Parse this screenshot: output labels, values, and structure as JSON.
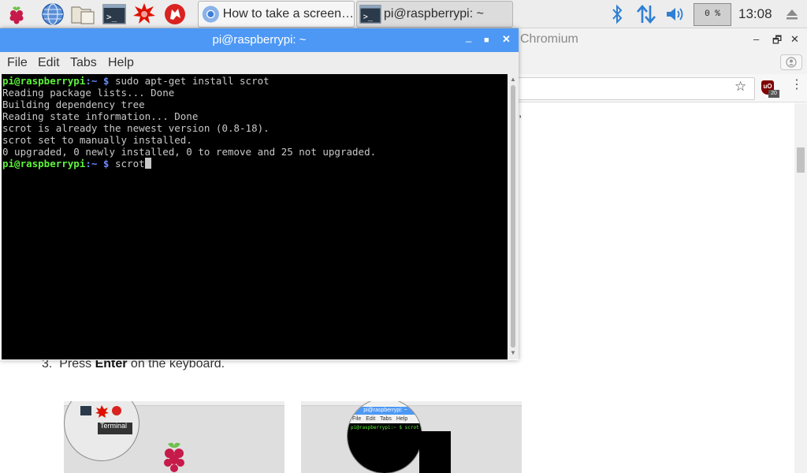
{
  "panel": {
    "launchers": [
      {
        "name": "raspberry-menu",
        "icon": "raspberry-icon"
      },
      {
        "name": "web-browser",
        "icon": "globe-icon"
      },
      {
        "name": "file-manager",
        "icon": "folder-icon"
      },
      {
        "name": "terminal",
        "icon": "terminal-icon"
      },
      {
        "name": "mathematica",
        "icon": "mathematica-icon"
      },
      {
        "name": "wolfram",
        "icon": "wolfram-icon"
      }
    ],
    "tasks": [
      {
        "label": "How to take a screen…",
        "icon": "chromium-icon",
        "active": true
      },
      {
        "label": "pi@raspberrypi: ~",
        "icon": "terminal-icon",
        "active": false
      }
    ],
    "cpu": "0 %",
    "clock": "13:08",
    "colors": {
      "bluetooth": "#2f7fd5",
      "network": "#2f7fd5",
      "volume": "#2f7fd5"
    }
  },
  "chromium": {
    "title_fragment": "Chromium",
    "minimize": "–",
    "maximize": "🗗",
    "close": "✕",
    "ublock_label": "uO",
    "ublock_count": "20",
    "content_fragment": "’,",
    "step_number": "3.",
    "step_pre": "Press ",
    "step_bold": "Enter",
    "step_post": " on the keyboard.",
    "thumb1_tooltip": "Terminal",
    "thumb2_title": "pi@raspberrypi: ~",
    "thumb2_menu": [
      "File",
      "Edit",
      "Tabs",
      "Help"
    ],
    "thumb2_prompt": "pi@raspberrypi:~ $ scrot"
  },
  "terminal": {
    "title": "pi@raspberrypi: ~",
    "controls": {
      "minimize": "_",
      "maximize": "■",
      "close": "✕"
    },
    "menu": [
      "File",
      "Edit",
      "Tabs",
      "Help"
    ],
    "prompt_user": "pi@raspberrypi",
    "prompt_path": ":~ $",
    "command1": " sudo apt-get install scrot",
    "output": [
      "Reading package lists... Done",
      "Building dependency tree",
      "Reading state information... Done",
      "scrot is already the newest version (0.8-18).",
      "scrot set to manually installed.",
      "0 upgraded, 0 newly installed, 0 to remove and 25 not upgraded."
    ],
    "command2": " scrot",
    "colors": {
      "title_bar": "#4d98f5",
      "user": "#5df23a",
      "path": "#6b8af5"
    }
  }
}
